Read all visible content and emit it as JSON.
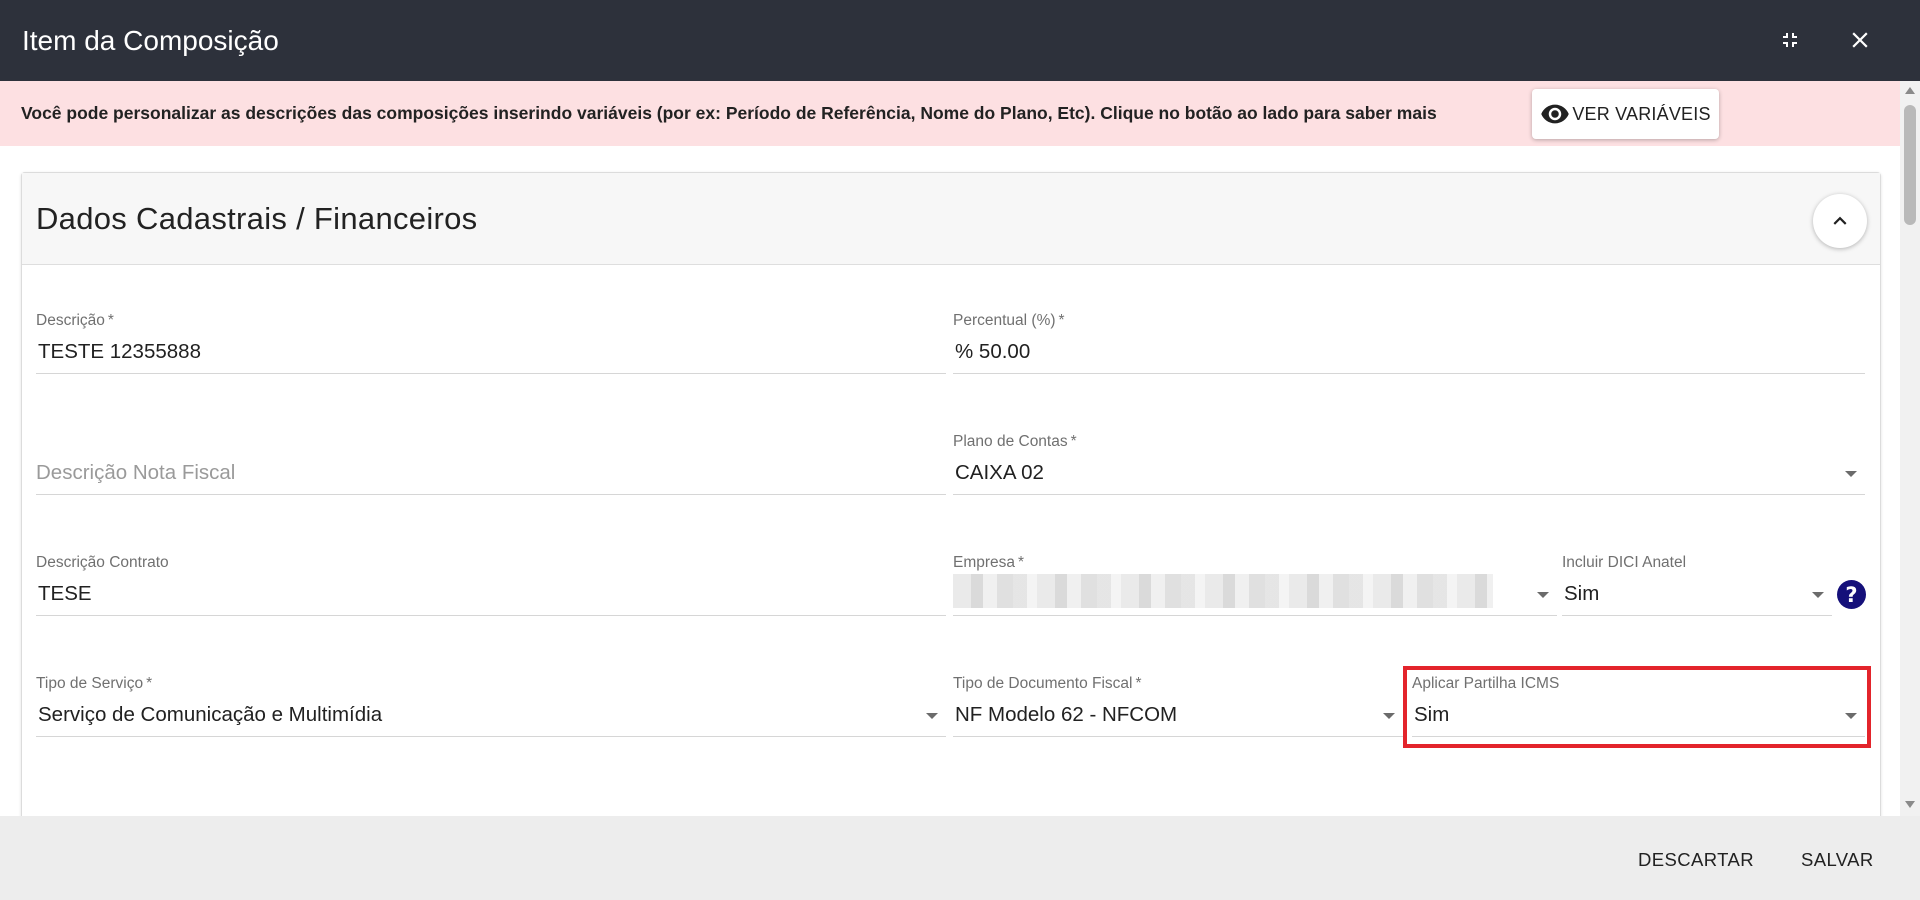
{
  "dialog": {
    "title": "Item da Composição"
  },
  "banner": {
    "message": "Você pode personalizar as descrições das composições inserindo variáveis (por ex: Período de Referência, Nome do Plano, Etc). Clique no botão ao lado para saber mais",
    "button_label": "VER VARIÁVEIS"
  },
  "section": {
    "title": "Dados Cadastrais / Financeiros"
  },
  "fields": {
    "descricao": {
      "label": "Descrição",
      "required": "*",
      "value": "TESTE 12355888"
    },
    "percentual": {
      "label": "Percentual (%)",
      "required": "*",
      "value": "% 50.00"
    },
    "descricao_nota_fiscal": {
      "placeholder": "Descrição Nota Fiscal"
    },
    "plano_de_contas": {
      "label": "Plano de Contas",
      "required": "*",
      "value": "CAIXA 02"
    },
    "descricao_contrato": {
      "label": "Descrição Contrato",
      "value": "TESE"
    },
    "empresa": {
      "label": "Empresa",
      "required": "*"
    },
    "incluir_dici_anatel": {
      "label": "Incluir DICI Anatel",
      "value": "Sim",
      "help": "?"
    },
    "tipo_de_servico": {
      "label": "Tipo de Serviço",
      "required": "*",
      "value": "Serviço de Comunicação e Multimídia"
    },
    "tipo_documento_fiscal": {
      "label": "Tipo de Documento Fiscal",
      "required": "*",
      "value": "NF Modelo 62 - NFCOM"
    },
    "aplicar_partilha_icms": {
      "label": "Aplicar Partilha ICMS",
      "value": "Sim"
    }
  },
  "footer": {
    "discard_label": "DESCARTAR",
    "save_label": "SALVAR"
  },
  "icons": {
    "minimize": "fullscreen-exit-icon",
    "close": "close-icon",
    "eye": "eye-icon",
    "collapse": "chevron-up-icon",
    "dropdown": "caret-down-icon",
    "help": "help-icon"
  },
  "colors": {
    "header_bg": "#2d313b",
    "banner_bg": "#fde0e2",
    "help_icon": "#15107a",
    "highlight": "#e3242b",
    "footer_bg": "#ededed"
  }
}
